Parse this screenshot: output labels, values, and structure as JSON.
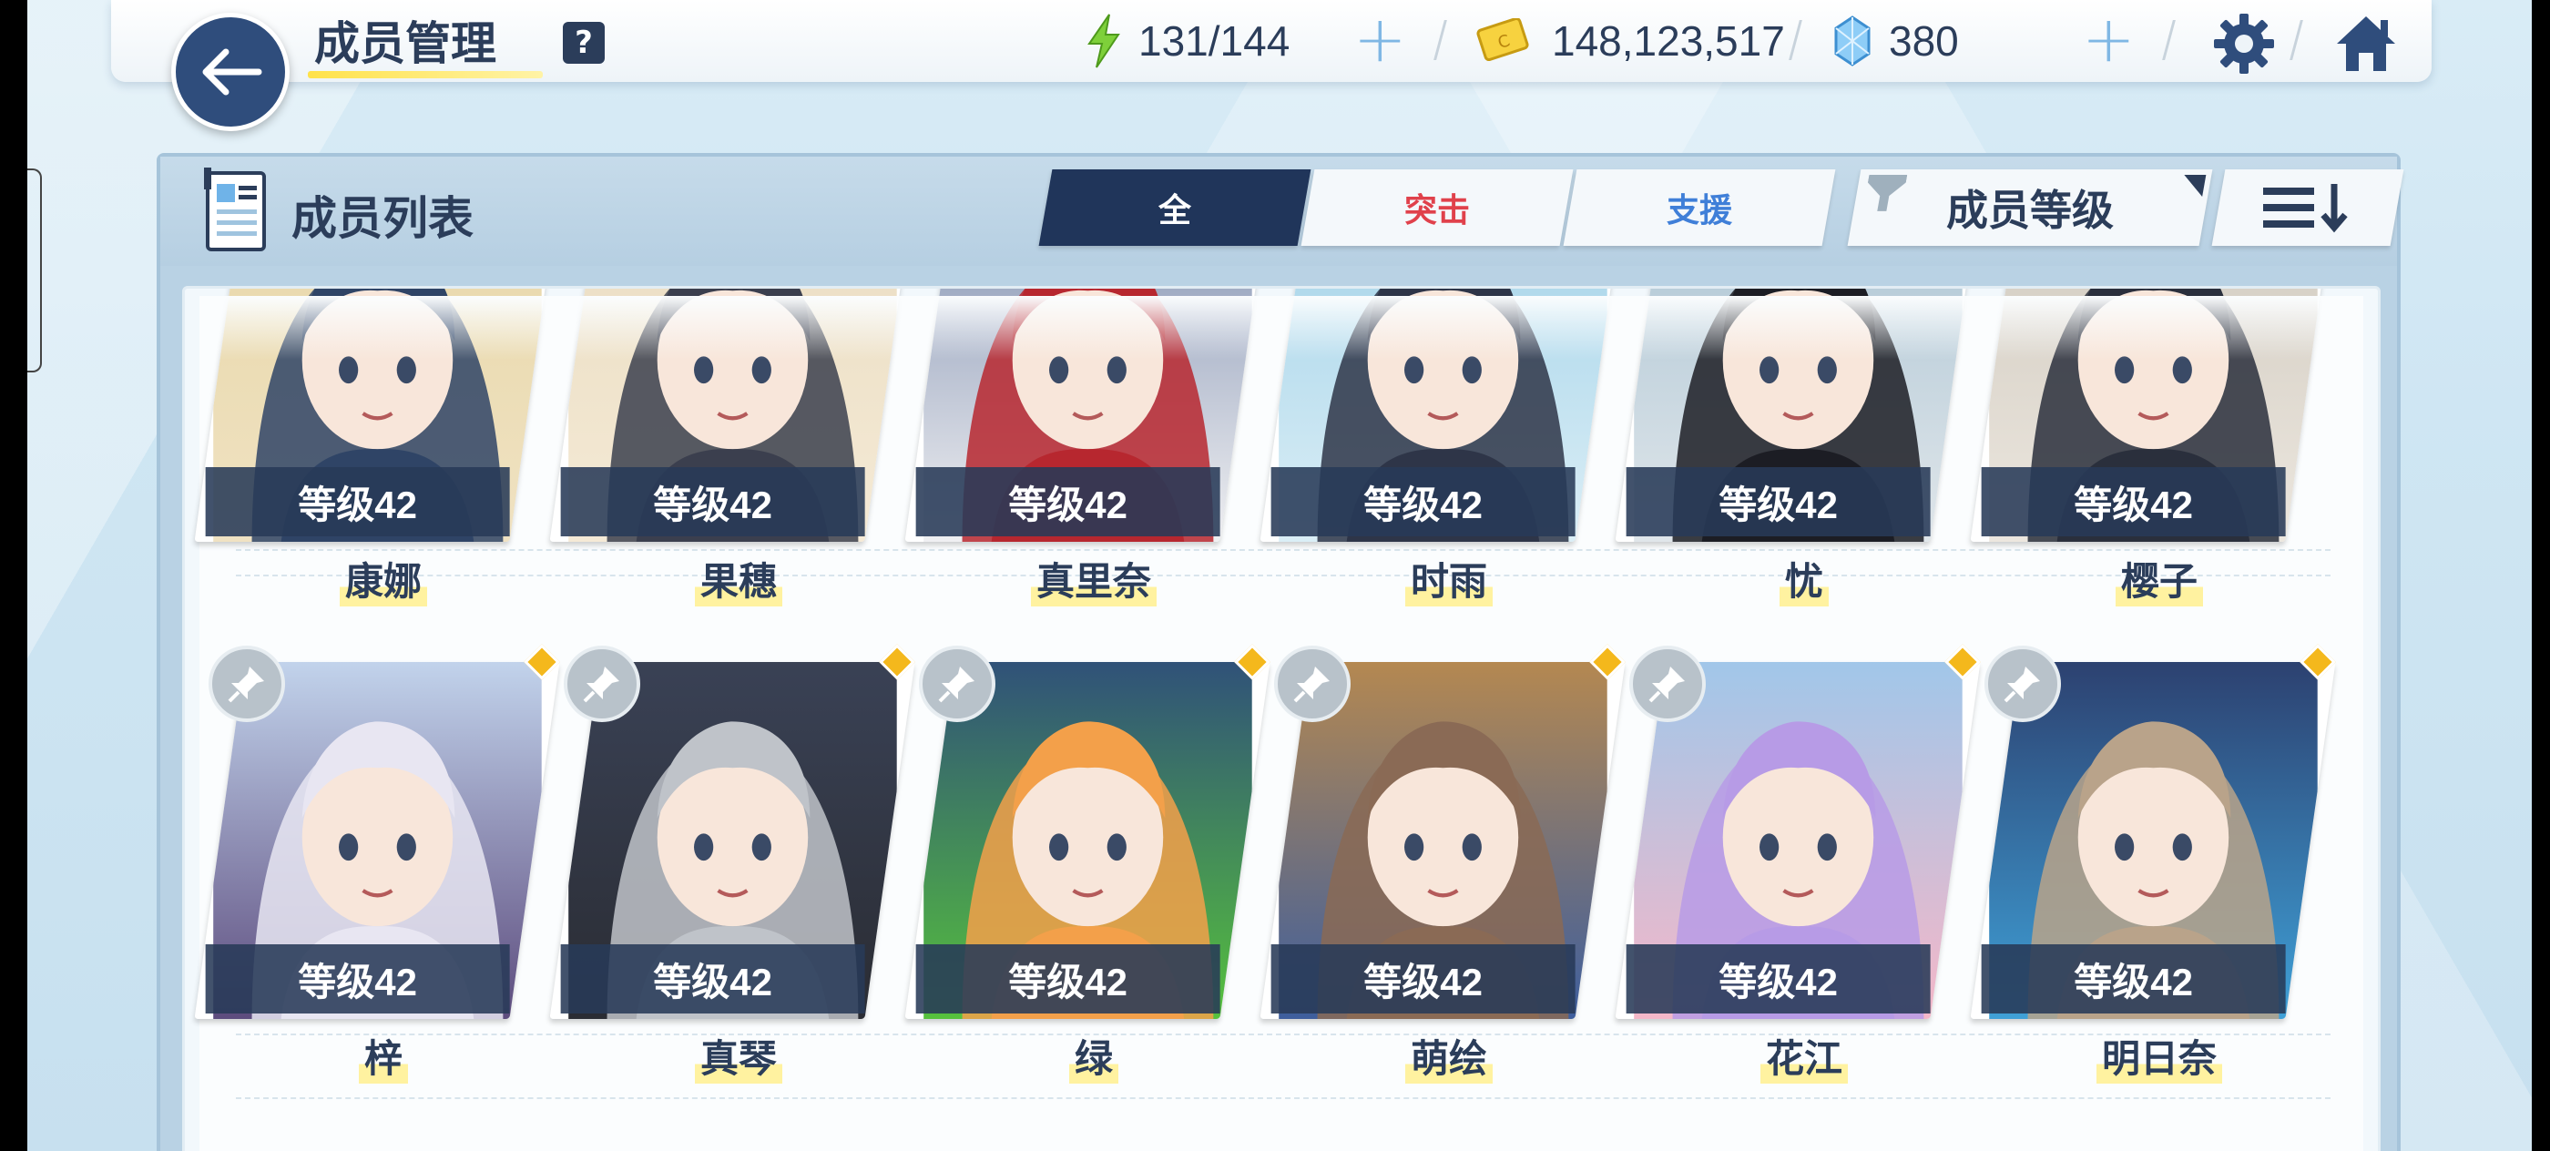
{
  "header": {
    "title": "成员管理",
    "help_label": "?",
    "ap": "131/144",
    "credits": "148,123,517",
    "gems": "380"
  },
  "panel": {
    "title": "成员列表",
    "tabs": [
      {
        "label": "全",
        "state": "active"
      },
      {
        "label": "突击",
        "color": "#e0414b"
      },
      {
        "label": "支援",
        "color": "#3f7fd8"
      }
    ],
    "sort_label": "成员等级"
  },
  "students": [
    {
      "name": "康娜",
      "level": "等级42",
      "palette": [
        "#e7d7a8",
        "#2f4466",
        "#f0e2c2"
      ]
    },
    {
      "name": "果穗",
      "level": "等级42",
      "palette": [
        "#e9dcc0",
        "#3b3f4e",
        "#f5ead6"
      ]
    },
    {
      "name": "真里奈",
      "level": "等级42",
      "palette": [
        "#7f8fb0",
        "#b7272f",
        "#f0f0f2"
      ]
    },
    {
      "name": "时雨",
      "level": "等级42",
      "palette": [
        "#9fd1e8",
        "#2e3548",
        "#dbeef6"
      ]
    },
    {
      "name": "忧",
      "level": "等级42",
      "palette": [
        "#a9c3d3",
        "#1c1d24",
        "#e0e6ea"
      ]
    },
    {
      "name": "樱子",
      "level": "等级42",
      "palette": [
        "#cfc8bd",
        "#2a2f3c",
        "#ece7df"
      ]
    },
    {
      "name": "梓",
      "level": "等级42",
      "palette": [
        "#c4d6ee",
        "#e8e6f2",
        "#5c4b7d"
      ]
    },
    {
      "name": "真琴",
      "level": "等级42",
      "palette": [
        "#3a4256",
        "#bfc3c9",
        "#2a2c33"
      ]
    },
    {
      "name": "绿",
      "level": "等级42",
      "palette": [
        "#2f4f7a",
        "#f3a04a",
        "#56c23c"
      ]
    },
    {
      "name": "萌绘",
      "level": "等级42",
      "palette": [
        "#b7894f",
        "#8a6a55",
        "#3d5e9e"
      ]
    },
    {
      "name": "花江",
      "level": "等级42",
      "palette": [
        "#9fc7ea",
        "#b79be6",
        "#f5b7c8"
      ]
    },
    {
      "name": "明日奈",
      "level": "等级42",
      "palette": [
        "#2c3f6e",
        "#b9a38a",
        "#3fa1d8"
      ]
    }
  ]
}
